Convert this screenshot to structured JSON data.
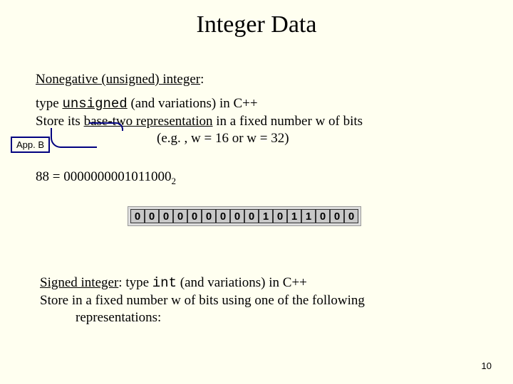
{
  "title": "Integer Data",
  "nonneg_heading": "Nonegative (unsigned) integer",
  "colon": ":",
  "p1_a": "type ",
  "p1_mono": "unsigned",
  "p1_b": " (and variations) in C++",
  "p2_a": "Store its ",
  "p2_u": "base-two representation",
  "p2_b": " in a fixed number w of bits",
  "eg": "(e.g. , w = 16 or w = 32)",
  "appb": "App. B",
  "eq_lhs": "88 = ",
  "eq_bits": "0000000001011000",
  "eq_sub": "2",
  "bits": [
    "0",
    "0",
    "0",
    "0",
    "0",
    "0",
    "0",
    "0",
    "0",
    "1",
    "0",
    "1",
    "1",
    "0",
    "0",
    "0"
  ],
  "signed_label": "Signed integer",
  "signed_a": "   type ",
  "signed_mono": "int",
  "signed_b": " (and variations) in C++",
  "signed_l2": "Store in a fixed number w of bits using one of the following",
  "signed_l3": "representations:",
  "page_number": "10"
}
